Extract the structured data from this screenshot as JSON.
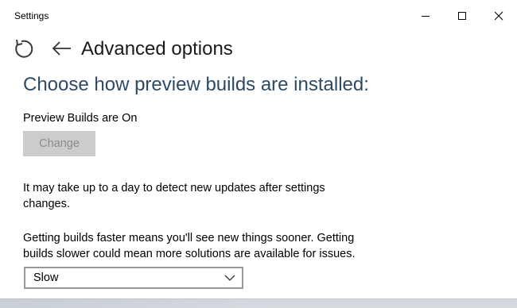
{
  "window": {
    "title": "Settings",
    "controls": {
      "minimize": "minimize-icon",
      "maximize": "maximize-icon",
      "close": "close-icon"
    }
  },
  "header": {
    "reload_icon": "reload-icon",
    "back_icon": "back-arrow-icon",
    "page_title": "Advanced options"
  },
  "main": {
    "heading": "Choose how preview builds are installed:",
    "status": "Preview Builds are On",
    "change_button": "Change",
    "info_detect": "It may take up to a day to detect new updates after settings changes.",
    "info_speed": "Getting builds faster means you'll see new things sooner. Getting builds slower could mean more solutions are available for issues.",
    "speed_select": {
      "value": "Slow"
    }
  },
  "colors": {
    "heading": "#2d4a66",
    "button_disabled_bg": "#cccccc",
    "button_disabled_text": "#8c8c8c"
  }
}
